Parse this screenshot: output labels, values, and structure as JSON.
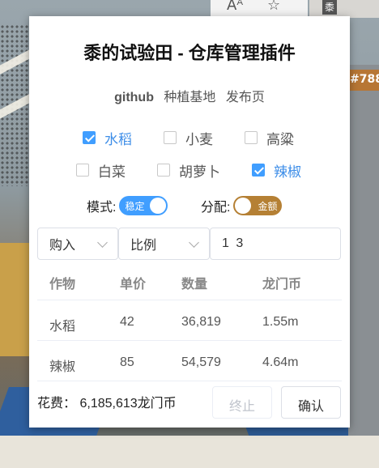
{
  "browser": {
    "read_aloud_icon": "Aᴬ",
    "favorite_icon": "☆",
    "extension_icon_text": "黍"
  },
  "background": {
    "tag_text": "#788"
  },
  "popup": {
    "title": "黍的试验田 - 仓库管理插件",
    "links": [
      "github",
      "种植基地",
      "发布页"
    ],
    "crops": [
      {
        "label": "水稻",
        "checked": true
      },
      {
        "label": "小麦",
        "checked": false
      },
      {
        "label": "高粱",
        "checked": false
      },
      {
        "label": "白菜",
        "checked": false
      },
      {
        "label": "胡萝卜",
        "checked": false
      },
      {
        "label": "辣椒",
        "checked": true
      }
    ],
    "mode": {
      "label": "模式:",
      "value": "稳定",
      "color": "#409eff"
    },
    "allocation": {
      "label": "分配:",
      "value": "金额",
      "color": "#b58034"
    },
    "action_select": {
      "value": "购入"
    },
    "ratio_select": {
      "value": "比例"
    },
    "ratio_input": {
      "value": "1 3"
    },
    "table": {
      "headers": [
        "作物",
        "单价",
        "数量",
        "龙门币"
      ],
      "rows": [
        [
          "水稻",
          "42",
          "36,819",
          "1.55m"
        ],
        [
          "辣椒",
          "85",
          "54,579",
          "4.64m"
        ]
      ]
    },
    "cost_label": "花费：",
    "cost_value": "6,185,613龙门币",
    "stop_button": "终止",
    "confirm_button": "确认"
  }
}
